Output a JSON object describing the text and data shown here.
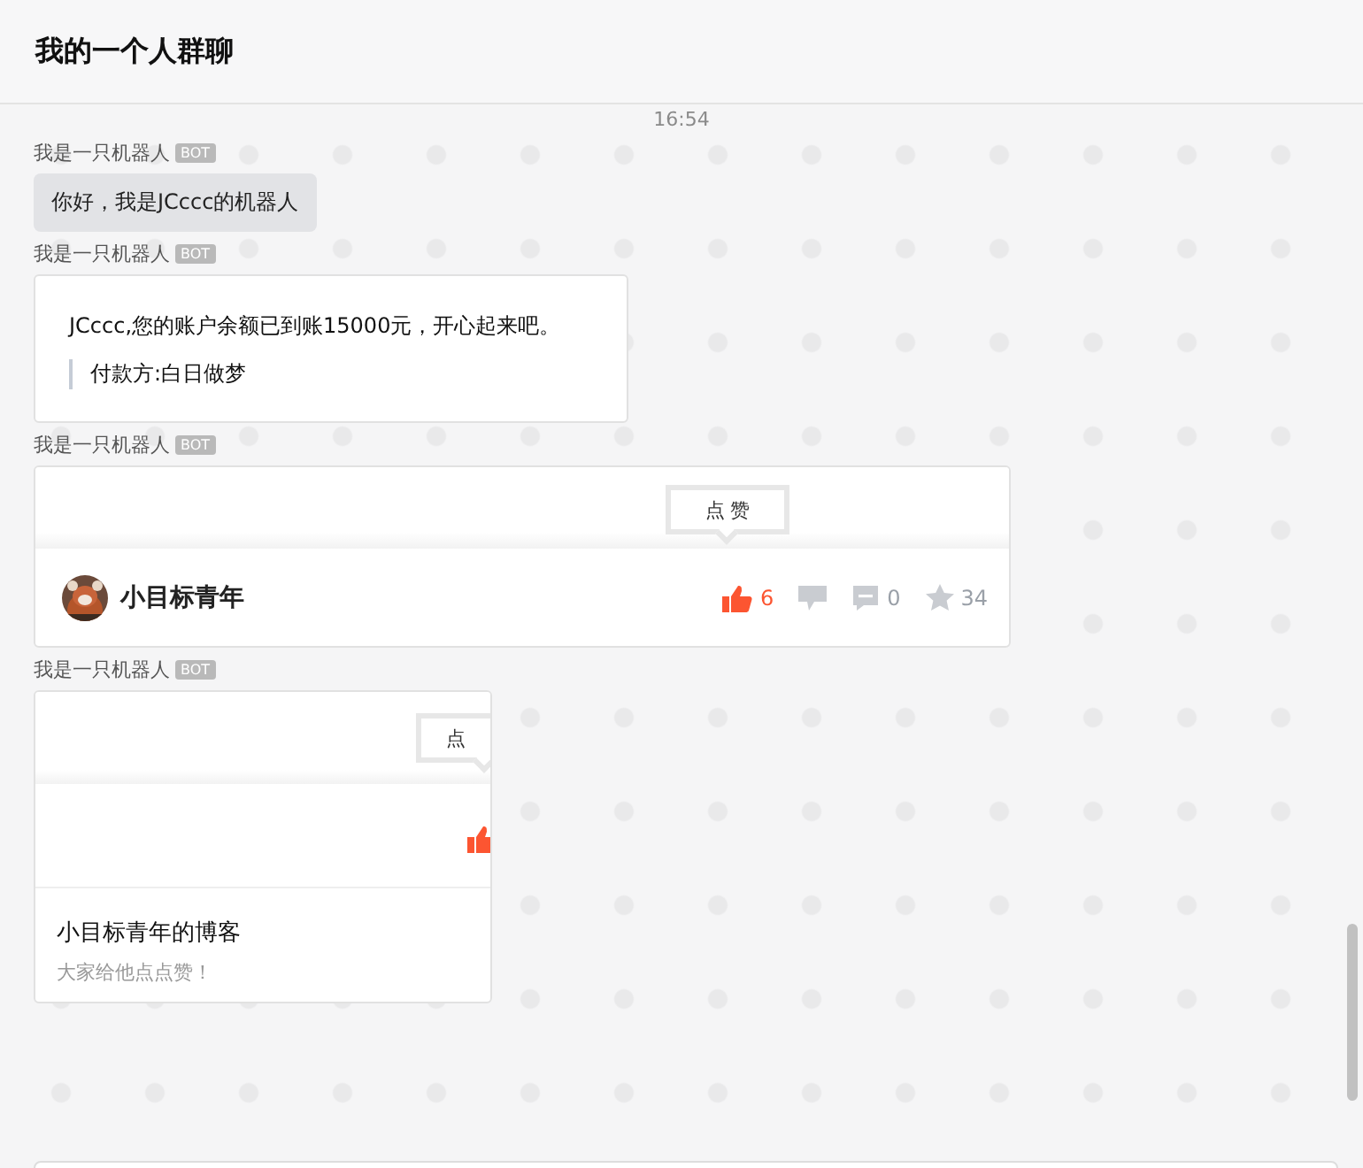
{
  "chat": {
    "title": "我的一个人群聊"
  },
  "time": "16:54",
  "messages": [
    {
      "kind": "text",
      "sender": "我是一只机器人",
      "badge": "BOT",
      "text": "你好，我是JCccc的机器人"
    },
    {
      "kind": "markdown",
      "sender": "我是一只机器人",
      "badge": "BOT",
      "text": "JCccc,您的账户余额已到账15000元，开心起来吧。",
      "quote": "付款方:白日做梦"
    },
    {
      "kind": "feed",
      "sender": "我是一只机器人",
      "badge": "BOT",
      "tooltip": "点 赞",
      "author": "小目标青年",
      "stats": [
        {
          "kind": "like",
          "count": "6",
          "active": true
        },
        {
          "kind": "dislike",
          "active": false
        },
        {
          "kind": "comment",
          "count": "0",
          "active": false
        },
        {
          "kind": "star",
          "count": "34",
          "active": false
        }
      ]
    },
    {
      "kind": "link",
      "sender": "我是一只机器人",
      "badge": "BOT",
      "tooltip": "点",
      "title": "小目标青年的博客",
      "text": "大家给他点点赞！"
    }
  ]
}
